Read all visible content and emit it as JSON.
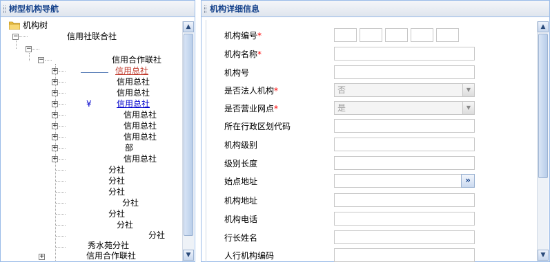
{
  "left_panel": {
    "title": "树型机构导航",
    "root_label": "机构树",
    "nodes": [
      {
        "label": "信用社联合社"
      },
      {
        "label": "信用合作联社"
      },
      {
        "label": "信用总社"
      },
      {
        "label": "信用总社"
      },
      {
        "label": "信用总社"
      },
      {
        "label": "信用总社"
      },
      {
        "label": "信用总社"
      },
      {
        "label": "信用总社"
      },
      {
        "label": "信用总社"
      },
      {
        "label": "部"
      },
      {
        "label": "信用总社"
      },
      {
        "label": "分社"
      },
      {
        "label": "分社"
      },
      {
        "label": "分社"
      },
      {
        "label": "分社"
      },
      {
        "label": "分社"
      },
      {
        "label": "分社"
      },
      {
        "label": "分社"
      },
      {
        "label": "秀水苑分社"
      },
      {
        "label": "信用合作联社"
      }
    ]
  },
  "right_panel": {
    "title": "机构详细信息",
    "fields": [
      {
        "label": "机构编号",
        "required": true,
        "value": ""
      },
      {
        "label": "机构名称",
        "required": true,
        "value": ""
      },
      {
        "label": "机构号",
        "required": false,
        "value": ""
      },
      {
        "label": "是否法人机构",
        "required": true,
        "value": "否"
      },
      {
        "label": "是否营业网点",
        "required": true,
        "value": "是"
      },
      {
        "label": "所在行政区划代码",
        "required": false,
        "value": ""
      },
      {
        "label": "机构级别",
        "required": false,
        "value": ""
      },
      {
        "label": "级别长度",
        "required": false,
        "value": ""
      },
      {
        "label": "始点地址",
        "required": false,
        "value": "",
        "button": "»"
      },
      {
        "label": "机构地址",
        "required": false,
        "value": ""
      },
      {
        "label": "机构电话",
        "required": false,
        "value": ""
      },
      {
        "label": "行长姓名",
        "required": false,
        "value": ""
      },
      {
        "label": "人行机构编码",
        "required": false,
        "value": ""
      }
    ],
    "required_mark": "*"
  },
  "icons": {
    "expand": "plus-box",
    "collapse": "minus-box",
    "root": "folder-icon",
    "scroll_up": "▲",
    "scroll_down": "▼",
    "select_arrow": "▼"
  }
}
